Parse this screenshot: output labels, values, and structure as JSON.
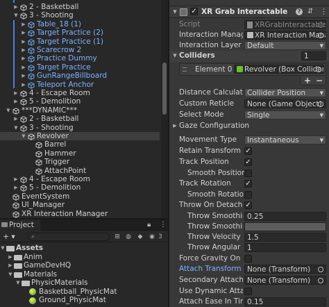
{
  "hierarchy": {
    "items": [
      {
        "label": "2 - Basketball",
        "indent": 2,
        "arrow": "right",
        "style": "normal"
      },
      {
        "label": "3 - Shooting",
        "indent": 2,
        "arrow": "down",
        "style": "normal"
      },
      {
        "label": "Table_18 (1)",
        "indent": 3,
        "arrow": "right",
        "style": "blue"
      },
      {
        "label": "Target Practice (2)",
        "indent": 3,
        "arrow": "right",
        "style": "blue"
      },
      {
        "label": "Target Practice (1)",
        "indent": 3,
        "arrow": "right",
        "style": "blue"
      },
      {
        "label": "Scarecrow 2",
        "indent": 3,
        "arrow": "right",
        "style": "blue"
      },
      {
        "label": "Practice Dummy",
        "indent": 3,
        "arrow": "right",
        "style": "blue"
      },
      {
        "label": "Target Practice",
        "indent": 3,
        "arrow": "right",
        "style": "blue"
      },
      {
        "label": "GunRangeBillboard",
        "indent": 3,
        "arrow": "right",
        "style": "blue"
      },
      {
        "label": "Teleport Anchor",
        "indent": 3,
        "arrow": "right",
        "style": "blue"
      },
      {
        "label": "4 - Escape Room",
        "indent": 2,
        "arrow": "right",
        "style": "normal"
      },
      {
        "label": "5 - Demolition",
        "indent": 2,
        "arrow": "right",
        "style": "normal"
      },
      {
        "label": "***DYNAMIC***",
        "indent": 1,
        "arrow": "down",
        "style": "normal"
      },
      {
        "label": "2 - Basketball",
        "indent": 2,
        "arrow": "right",
        "style": "normal"
      },
      {
        "label": "3 - Shooting",
        "indent": 2,
        "arrow": "down",
        "style": "normal"
      },
      {
        "label": "Revolver",
        "indent": 3,
        "arrow": "down",
        "style": "selected"
      },
      {
        "label": "Barrel",
        "indent": 4,
        "arrow": "",
        "style": "normal"
      },
      {
        "label": "Hammer",
        "indent": 4,
        "arrow": "",
        "style": "normal"
      },
      {
        "label": "Trigger",
        "indent": 4,
        "arrow": "",
        "style": "normal"
      },
      {
        "label": "AttachPoint",
        "indent": 4,
        "arrow": "",
        "style": "normal"
      },
      {
        "label": "4 - Escape Room",
        "indent": 2,
        "arrow": "right",
        "style": "normal"
      },
      {
        "label": "5 - Demolition",
        "indent": 2,
        "arrow": "right",
        "style": "normal"
      },
      {
        "label": "EventSystem",
        "indent": 1,
        "arrow": "",
        "style": "normal"
      },
      {
        "label": "UI_Manager",
        "indent": 1,
        "arrow": "",
        "style": "normal"
      },
      {
        "label": "XR Interaction Manager",
        "indent": 1,
        "arrow": "",
        "style": "normal"
      }
    ]
  },
  "project": {
    "tab_label": "Project",
    "add_label": "+ ▾",
    "hidden_count": "3",
    "items": [
      {
        "label": "Assets",
        "indent": 0,
        "arrow": "down",
        "type": "folder",
        "bold": true
      },
      {
        "label": "Anim",
        "indent": 1,
        "arrow": "right",
        "type": "folder",
        "bold": false
      },
      {
        "label": "GameDevHQ",
        "indent": 1,
        "arrow": "right",
        "type": "folder",
        "bold": false
      },
      {
        "label": "Materials",
        "indent": 1,
        "arrow": "down",
        "type": "folder",
        "bold": false
      },
      {
        "label": "PhysicMaterials",
        "indent": 2,
        "arrow": "down",
        "type": "folder",
        "bold": false
      },
      {
        "label": "Basketball_PhysicMat",
        "indent": 3,
        "arrow": "",
        "type": "material",
        "bold": false
      },
      {
        "label": "Ground_PhysicMat",
        "indent": 3,
        "arrow": "",
        "type": "material",
        "bold": false
      }
    ]
  },
  "inspector": {
    "component_title": "XR Grab Interactable",
    "script_label": "Script",
    "script_value": "XRGrabInteractable",
    "interaction_manager_label": "Interaction Manager",
    "interaction_manager_value": "XR Interaction Manag",
    "interaction_layer_label": "Interaction Layer Mas",
    "interaction_layer_value": "Default",
    "colliders_label": "Colliders",
    "colliders_count": "1",
    "element0_label": "Element 0",
    "element0_value": "Revolver (Box Collider)",
    "plus_label": "+",
    "minus_label": "−",
    "distance_calc_label": "Distance Calculation",
    "distance_calc_value": "Collider Position",
    "custom_reticle_label": "Custom Reticle",
    "custom_reticle_value": "None (Game Object)",
    "select_mode_label": "Select Mode",
    "select_mode_value": "Single",
    "gaze_config_label": "Gaze Configuration",
    "movement_type_label": "Movement Type",
    "movement_type_value": "Instantaneous",
    "retain_transform_label": "Retain Transform Par",
    "retain_transform_checked": true,
    "track_position_label": "Track Position",
    "track_position_checked": true,
    "smooth_position_label": "Smooth Position",
    "smooth_position_checked": false,
    "track_rotation_label": "Track Rotation",
    "track_rotation_checked": true,
    "smooth_rotation_label": "Smooth Rotation",
    "smooth_rotation_checked": false,
    "throw_on_detach_label": "Throw On Detach",
    "throw_on_detach_checked": true,
    "throw_smoothing_d_label": "Throw Smoothing D",
    "throw_smoothing_d_value": "0.25",
    "throw_smoothing_c_label": "Throw Smoothing C",
    "throw_velocity_label": "Throw Velocity Sc",
    "throw_velocity_value": "1.5",
    "throw_angular_label": "Throw Angular Vel",
    "throw_angular_value": "1",
    "force_gravity_label": "Force Gravity On Det",
    "force_gravity_checked": false,
    "attach_transform_label": "Attach Transform",
    "attach_transform_value": "None (Transform)",
    "secondary_attach_label": "Secondary Attach Tra",
    "secondary_attach_value": "None (Transform)",
    "use_dynamic_attach_label": "Use Dynamic Attach",
    "use_dynamic_attach_checked": false,
    "attach_ease_label": "Attach Ease In Time",
    "attach_ease_value": "0.15"
  },
  "colors": {
    "panel_bg": "#282828",
    "inspector_bg": "#383838",
    "selection": "#2c5d87",
    "prefab_blue": "#7fb2ff",
    "accent_green": "#6abf2a"
  }
}
